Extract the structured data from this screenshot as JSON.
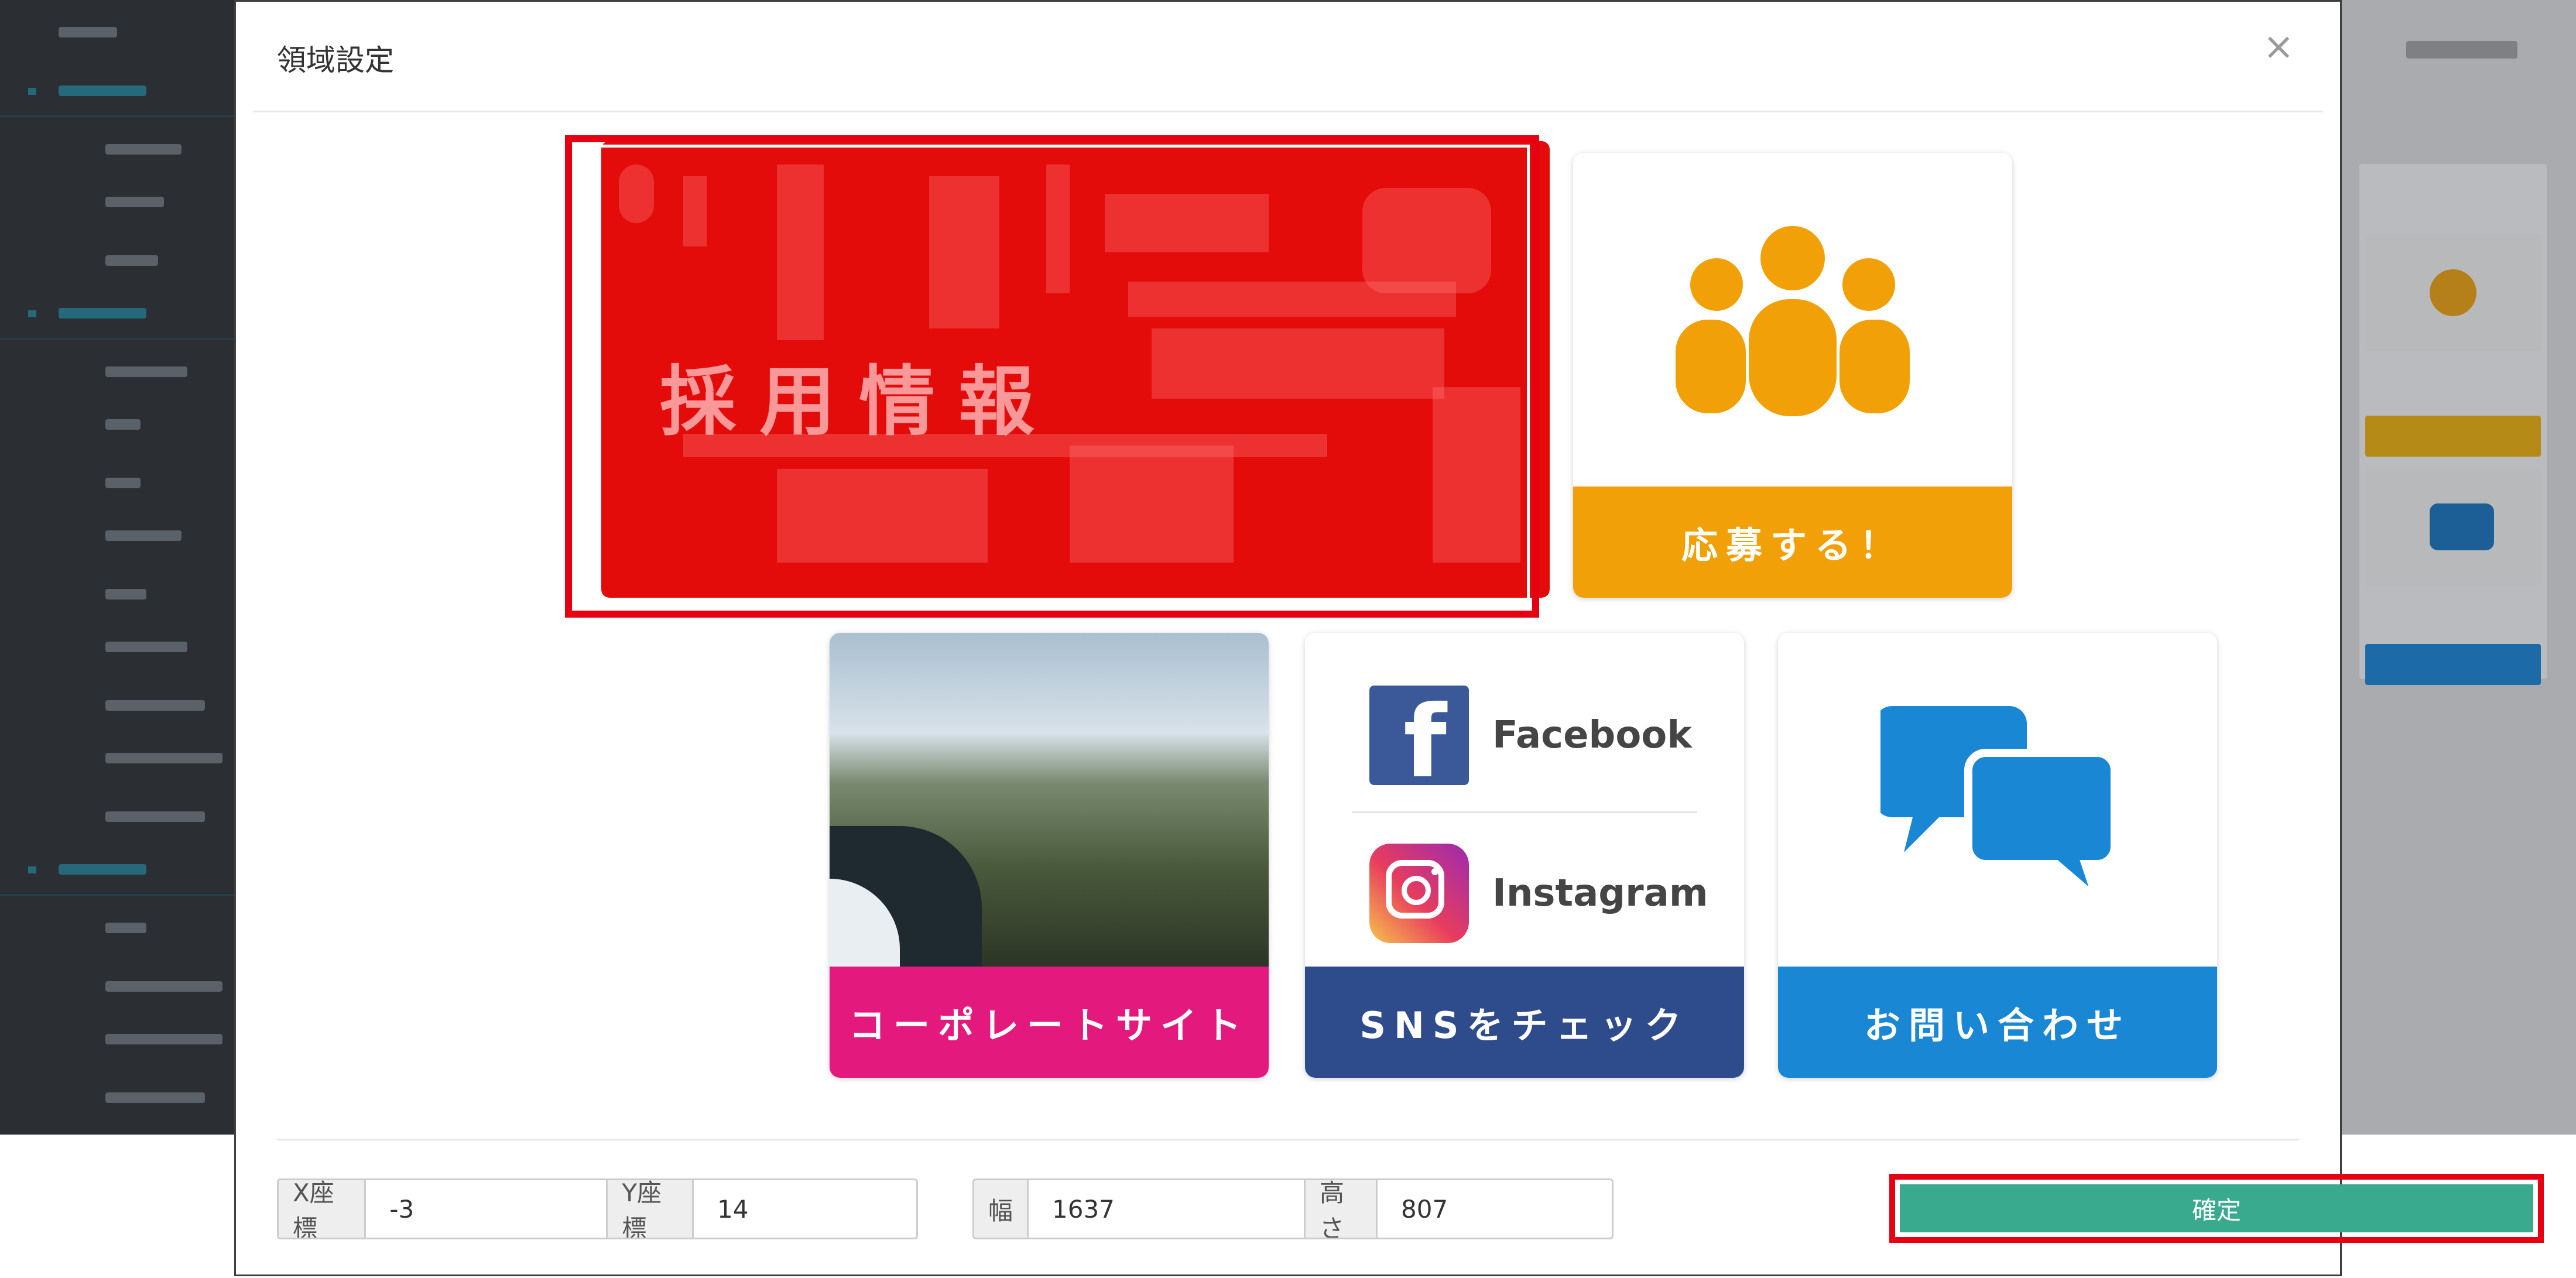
{
  "modal": {
    "title": "領域設定",
    "close_label": "×"
  },
  "tiles": {
    "recruit_label": "採用情報",
    "apply_label": "応募する！",
    "corporate_label": "コーポレートサイト",
    "sns_label": "SNSをチェック",
    "contact_label": "お問い合わせ",
    "facebook_name": "Facebook",
    "instagram_name": "Instagram"
  },
  "fields": {
    "x_label": "X座標",
    "x_value": "-3",
    "y_label": "Y座標",
    "y_value": "14",
    "width_label": "幅",
    "width_value": "1637",
    "height_label": "高さ",
    "height_value": "807"
  },
  "actions": {
    "confirm_label": "確定"
  },
  "colors": {
    "selection": "#e60012",
    "recruit_overlay": "#e40b0b",
    "apply_band": "#f2a007",
    "corporate_band": "#e4197e",
    "sns_band": "#2e4b8c",
    "contact_band": "#1a87d4",
    "confirm": "#3aaa8f"
  }
}
